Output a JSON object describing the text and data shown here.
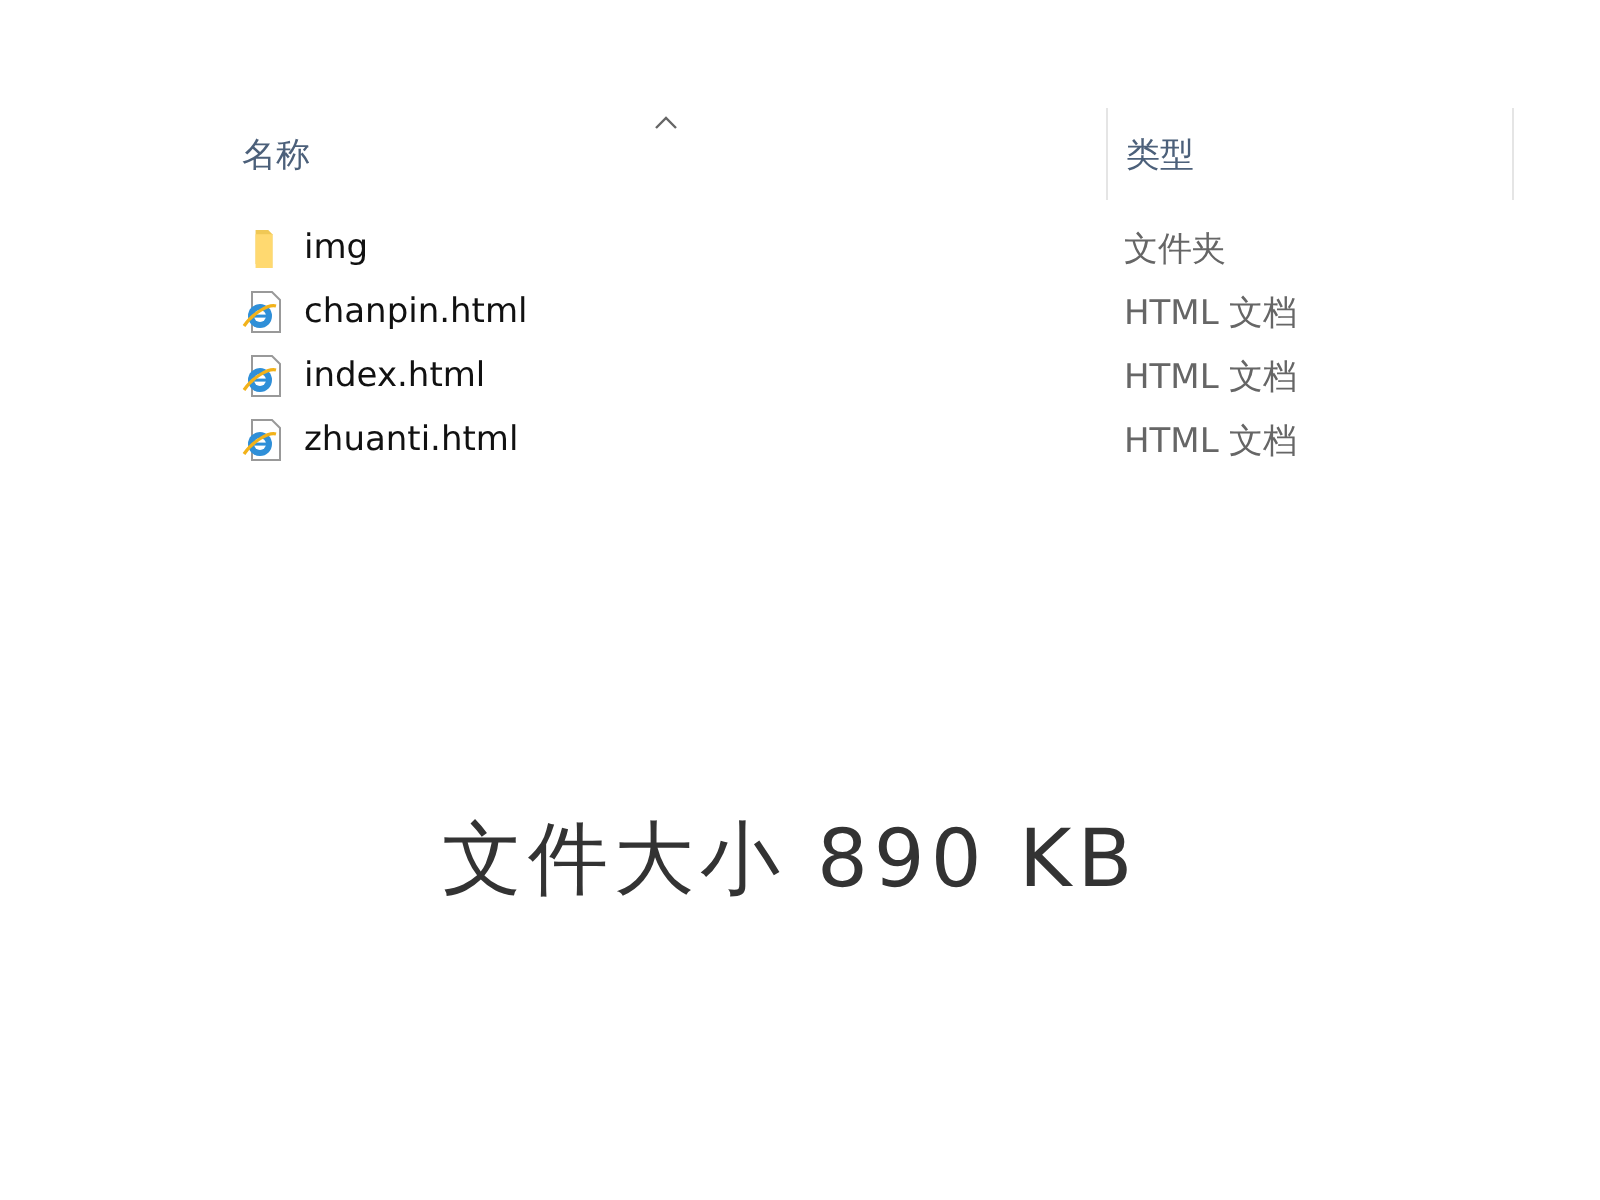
{
  "columns": [
    {
      "label": "名称",
      "sorted": true
    },
    {
      "label": "类型",
      "sorted": false
    }
  ],
  "files": [
    {
      "kind": "folder",
      "name": "img",
      "type": "文件夹"
    },
    {
      "kind": "html",
      "name": "chanpin.html",
      "type": "HTML 文档"
    },
    {
      "kind": "html",
      "name": "index.html",
      "type": "HTML 文档"
    },
    {
      "kind": "html",
      "name": "zhuanti.html",
      "type": "HTML 文档"
    }
  ],
  "caption": "文件大小 890 KB"
}
